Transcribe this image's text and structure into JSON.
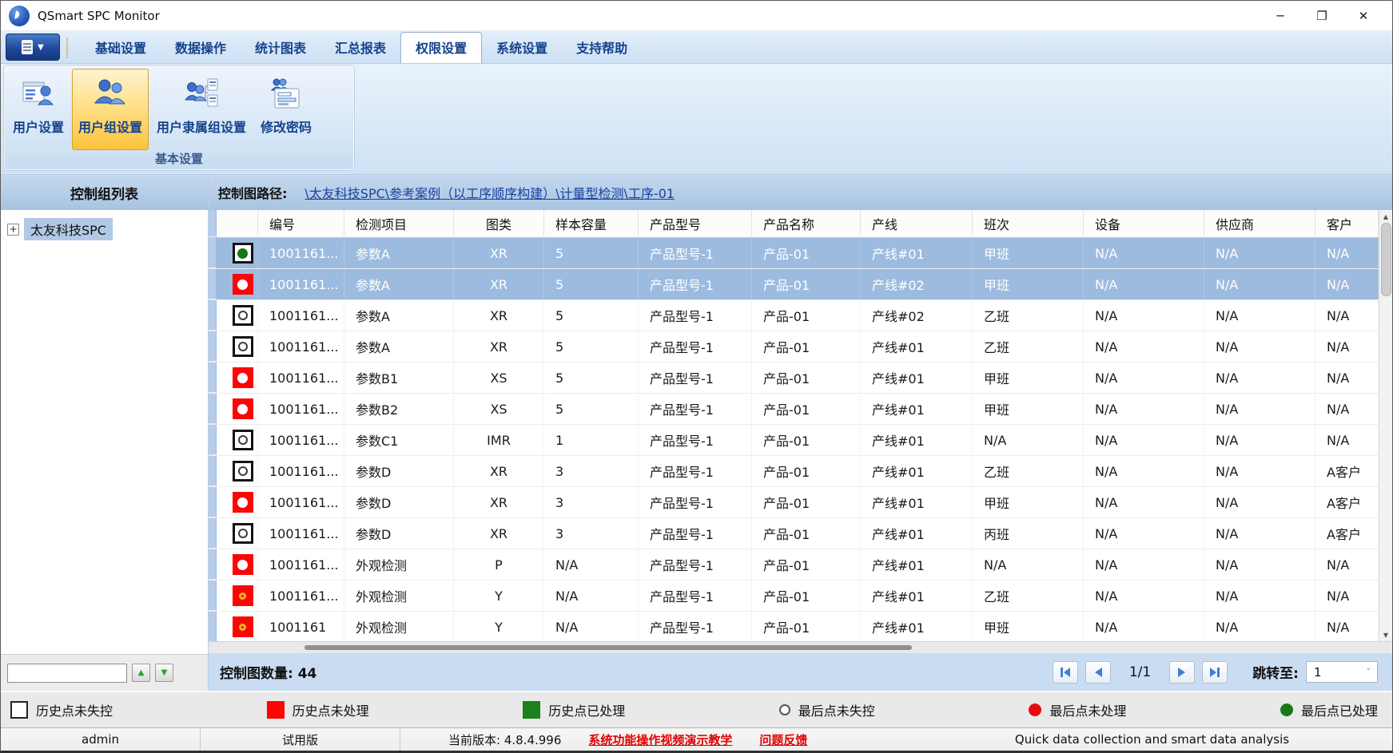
{
  "window": {
    "title": "QSmart SPC Monitor",
    "minimize": "─",
    "maximize": "❐",
    "close": "✕"
  },
  "menu": {
    "tabs": [
      "基础设置",
      "数据操作",
      "统计图表",
      "汇总报表",
      "权限设置",
      "系统设置",
      "支持帮助"
    ],
    "active_index": 4
  },
  "ribbon": {
    "buttons": [
      {
        "label": "用户设置",
        "active": false
      },
      {
        "label": "用户组设置",
        "active": true
      },
      {
        "label": "用户隶属组设置",
        "active": false
      },
      {
        "label": "修改密码",
        "active": false
      }
    ],
    "group_label": "基本设置"
  },
  "left_panel": {
    "title": "控制组列表",
    "expander": "+",
    "root_node": "太友科技SPC",
    "up_arrow": "▲",
    "down_arrow": "▼"
  },
  "path_bar": {
    "label": "控制图路径:",
    "path": "\\太友科技SPC\\参考案例（以工序顺序构建）\\计量型检测\\工序-01"
  },
  "table": {
    "columns": [
      "",
      "编号",
      "检测项目",
      "图类",
      "样本容量",
      "产品型号",
      "产品名称",
      "产线",
      "班次",
      "设备",
      "供应商",
      "客户"
    ],
    "rows": [
      {
        "selected": true,
        "square": "white",
        "dot": "green",
        "cells": [
          "1001161...",
          "参数A",
          "XR",
          "5",
          "产品型号-1",
          "产品-01",
          "产线#01",
          "甲班",
          "N/A",
          "N/A",
          "N/A"
        ]
      },
      {
        "selected": true,
        "square": "red",
        "dot": "white",
        "cells": [
          "1001161...",
          "参数A",
          "XR",
          "5",
          "产品型号-1",
          "产品-01",
          "产线#02",
          "甲班",
          "N/A",
          "N/A",
          "N/A"
        ]
      },
      {
        "selected": false,
        "square": "white",
        "dot": "outline",
        "cells": [
          "1001161...",
          "参数A",
          "XR",
          "5",
          "产品型号-1",
          "产品-01",
          "产线#02",
          "乙班",
          "N/A",
          "N/A",
          "N/A"
        ]
      },
      {
        "selected": false,
        "square": "white",
        "dot": "outline",
        "cells": [
          "1001161...",
          "参数A",
          "XR",
          "5",
          "产品型号-1",
          "产品-01",
          "产线#01",
          "乙班",
          "N/A",
          "N/A",
          "N/A"
        ]
      },
      {
        "selected": false,
        "square": "red",
        "dot": "white",
        "cells": [
          "1001161...",
          "参数B1",
          "XS",
          "5",
          "产品型号-1",
          "产品-01",
          "产线#01",
          "甲班",
          "N/A",
          "N/A",
          "N/A"
        ]
      },
      {
        "selected": false,
        "square": "red",
        "dot": "white",
        "cells": [
          "1001161...",
          "参数B2",
          "XS",
          "5",
          "产品型号-1",
          "产品-01",
          "产线#01",
          "甲班",
          "N/A",
          "N/A",
          "N/A"
        ]
      },
      {
        "selected": false,
        "square": "white",
        "dot": "outline",
        "cells": [
          "1001161...",
          "参数C1",
          "IMR",
          "1",
          "产品型号-1",
          "产品-01",
          "产线#01",
          "N/A",
          "N/A",
          "N/A",
          "N/A"
        ]
      },
      {
        "selected": false,
        "square": "white",
        "dot": "outline",
        "cells": [
          "1001161...",
          "参数D",
          "XR",
          "3",
          "产品型号-1",
          "产品-01",
          "产线#01",
          "乙班",
          "N/A",
          "N/A",
          "A客户"
        ]
      },
      {
        "selected": false,
        "square": "red",
        "dot": "white",
        "cells": [
          "1001161...",
          "参数D",
          "XR",
          "3",
          "产品型号-1",
          "产品-01",
          "产线#01",
          "甲班",
          "N/A",
          "N/A",
          "A客户"
        ]
      },
      {
        "selected": false,
        "square": "white",
        "dot": "outline",
        "cells": [
          "1001161...",
          "参数D",
          "XR",
          "3",
          "产品型号-1",
          "产品-01",
          "产线#01",
          "丙班",
          "N/A",
          "N/A",
          "A客户"
        ]
      },
      {
        "selected": false,
        "square": "red",
        "dot": "white",
        "cells": [
          "1001161...",
          "外观检测",
          "P",
          "N/A",
          "产品型号-1",
          "产品-01",
          "产线#01",
          "N/A",
          "N/A",
          "N/A",
          "N/A"
        ]
      },
      {
        "selected": false,
        "square": "red",
        "dot": "ring",
        "cells": [
          "1001161...",
          "外观检测",
          "Y",
          "N/A",
          "产品型号-1",
          "产品-01",
          "产线#01",
          "乙班",
          "N/A",
          "N/A",
          "N/A"
        ]
      },
      {
        "selected": false,
        "square": "red",
        "dot": "ring",
        "cells": [
          "1001161",
          "外观检测",
          "Y",
          "N/A",
          "产品型号-1",
          "产品-01",
          "产线#01",
          "甲班",
          "N/A",
          "N/A",
          "N/A"
        ]
      }
    ]
  },
  "footer": {
    "count_label": "控制图数量: 44",
    "page_label": "1/1",
    "goto_label": "跳转至:",
    "goto_value": "1",
    "chevron": "˅"
  },
  "scrollbar": {
    "up_arrow": "▲",
    "down_arrow": "▼"
  },
  "legend": {
    "items": [
      {
        "shape": "square-white",
        "label": "历史点未失控"
      },
      {
        "shape": "square-red",
        "label": "历史点未处理"
      },
      {
        "shape": "square-green",
        "label": "历史点已处理"
      },
      {
        "shape": "circle-outline",
        "label": "最后点未失控"
      },
      {
        "shape": "circle-red",
        "label": "最后点未处理"
      },
      {
        "shape": "circle-green",
        "label": "最后点已处理"
      }
    ]
  },
  "status_bar": {
    "user": "admin",
    "edition": "试用版",
    "version": "当前版本: 4.8.4.996",
    "link_video": "系统功能操作视频演示教学",
    "link_feedback": "问题反馈",
    "slogan": "Quick data collection and smart data analysis"
  }
}
